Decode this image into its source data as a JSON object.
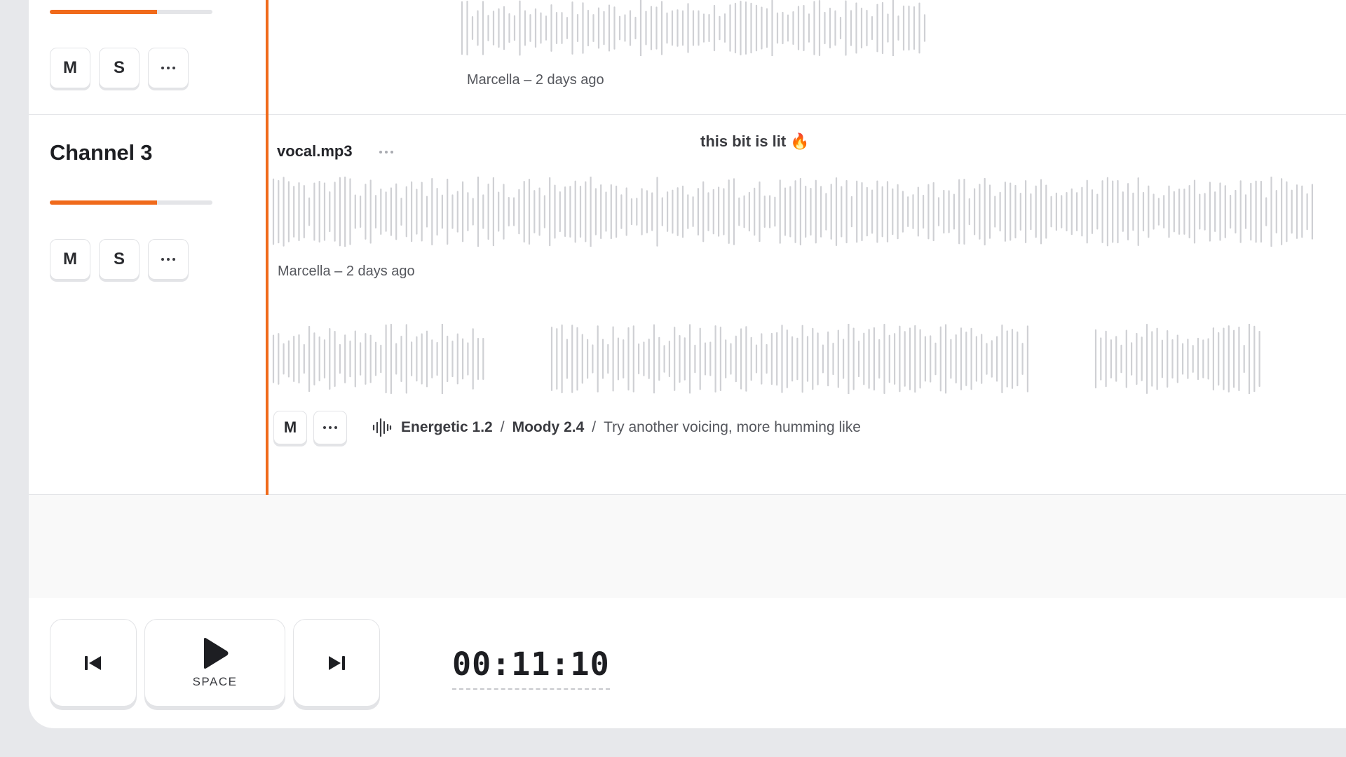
{
  "track_above": {
    "volume_level": 0.66,
    "mute_label": "M",
    "solo_label": "S",
    "more_icon": "more-icon",
    "clip_meta": "Marcella – 2 days ago"
  },
  "channel3": {
    "name": "Channel 3",
    "volume_level": 0.66,
    "mute_label": "M",
    "solo_label": "S",
    "more_icon": "more-icon",
    "clip": {
      "file_name": "vocal.mp3",
      "comment": "this bit is lit 🔥",
      "meta": "Marcella – 2 days ago"
    },
    "take": {
      "mute_label": "M",
      "icon": "waveform-icon",
      "breadcrumb": [
        "Energetic 1.2",
        "Moody 2.4"
      ],
      "note": "Try another voicing, more humming like",
      "separator": "/"
    }
  },
  "transport": {
    "prev_icon": "skip-back-icon",
    "play_icon": "play-icon",
    "play_shortcut": "SPACE",
    "next_icon": "skip-forward-icon",
    "time": "00:11:10"
  },
  "colors": {
    "accent": "#f06a1b",
    "waveform": "#cfd0d4",
    "background": "#e7e8eb"
  }
}
